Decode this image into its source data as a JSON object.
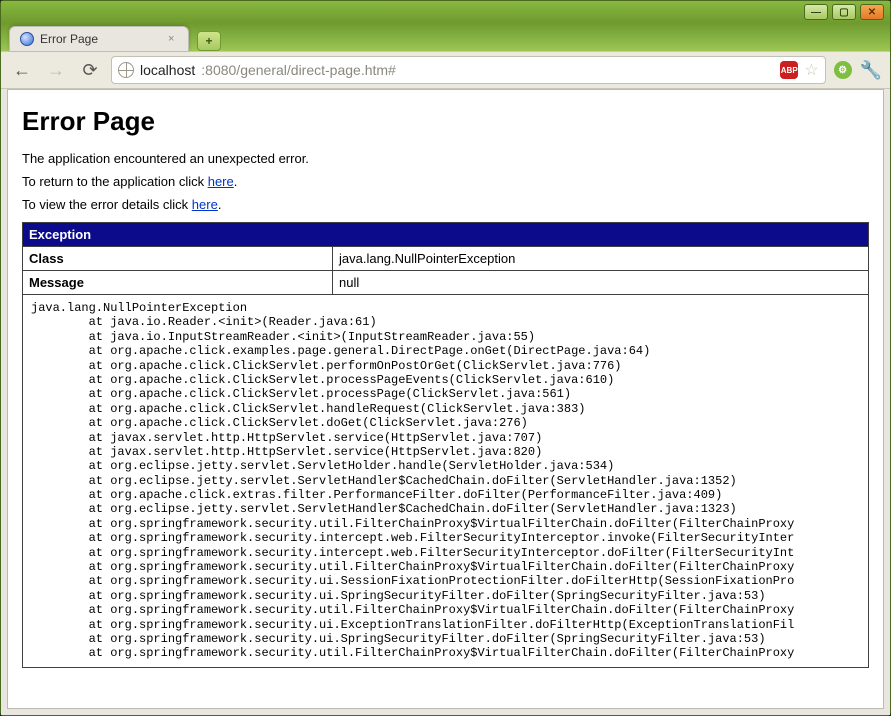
{
  "window": {
    "minimize": "—",
    "maximize": "▢",
    "close": "✕"
  },
  "browser": {
    "tab_title": "Error Page",
    "tab_close": "×",
    "newtab": "+",
    "nav": {
      "back": "←",
      "forward": "→",
      "reload": "⟳"
    },
    "url_host": "localhost",
    "url_port_path": ":8080/general/direct-page.htm#",
    "abp": "ABP",
    "star": "☆",
    "ext": "⚙",
    "wrench": "🔧"
  },
  "page": {
    "heading": "Error Page",
    "line1": "The application encountered an unexpected error.",
    "return_prefix": "To return to the application click ",
    "return_link": "here",
    "return_suffix": ".",
    "details_prefix": "To view the error details click ",
    "details_link": "here",
    "details_suffix": "."
  },
  "exception": {
    "header": "Exception",
    "class_label": "Class",
    "class_value": "java.lang.NullPointerException",
    "message_label": "Message",
    "message_value": "null",
    "trace": "java.lang.NullPointerException\n        at java.io.Reader.<init>(Reader.java:61)\n        at java.io.InputStreamReader.<init>(InputStreamReader.java:55)\n        at org.apache.click.examples.page.general.DirectPage.onGet(DirectPage.java:64)\n        at org.apache.click.ClickServlet.performOnPostOrGet(ClickServlet.java:776)\n        at org.apache.click.ClickServlet.processPageEvents(ClickServlet.java:610)\n        at org.apache.click.ClickServlet.processPage(ClickServlet.java:561)\n        at org.apache.click.ClickServlet.handleRequest(ClickServlet.java:383)\n        at org.apache.click.ClickServlet.doGet(ClickServlet.java:276)\n        at javax.servlet.http.HttpServlet.service(HttpServlet.java:707)\n        at javax.servlet.http.HttpServlet.service(HttpServlet.java:820)\n        at org.eclipse.jetty.servlet.ServletHolder.handle(ServletHolder.java:534)\n        at org.eclipse.jetty.servlet.ServletHandler$CachedChain.doFilter(ServletHandler.java:1352)\n        at org.apache.click.extras.filter.PerformanceFilter.doFilter(PerformanceFilter.java:409)\n        at org.eclipse.jetty.servlet.ServletHandler$CachedChain.doFilter(ServletHandler.java:1323)\n        at org.springframework.security.util.FilterChainProxy$VirtualFilterChain.doFilter(FilterChainProxy\n        at org.springframework.security.intercept.web.FilterSecurityInterceptor.invoke(FilterSecurityInter\n        at org.springframework.security.intercept.web.FilterSecurityInterceptor.doFilter(FilterSecurityInt\n        at org.springframework.security.util.FilterChainProxy$VirtualFilterChain.doFilter(FilterChainProxy\n        at org.springframework.security.ui.SessionFixationProtectionFilter.doFilterHttp(SessionFixationPro\n        at org.springframework.security.ui.SpringSecurityFilter.doFilter(SpringSecurityFilter.java:53)\n        at org.springframework.security.util.FilterChainProxy$VirtualFilterChain.doFilter(FilterChainProxy\n        at org.springframework.security.ui.ExceptionTranslationFilter.doFilterHttp(ExceptionTranslationFil\n        at org.springframework.security.ui.SpringSecurityFilter.doFilter(SpringSecurityFilter.java:53)\n        at org.springframework.security.util.FilterChainProxy$VirtualFilterChain.doFilter(FilterChainProxy"
  }
}
